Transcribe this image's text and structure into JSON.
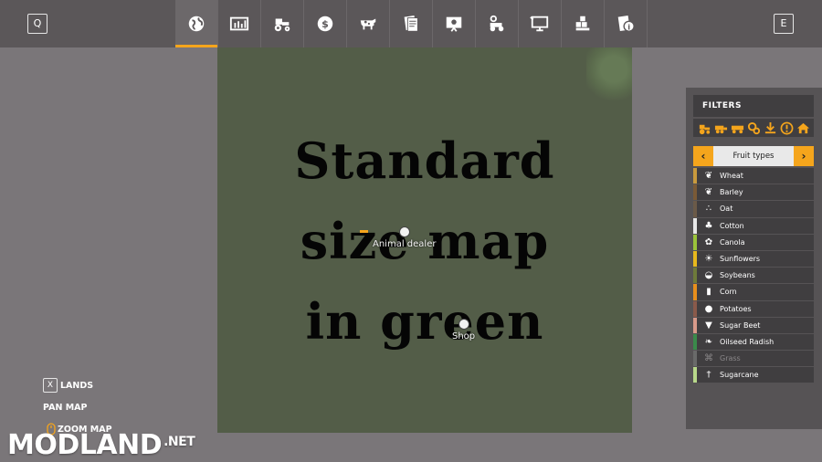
{
  "topbar": {
    "left_key": "Q",
    "right_key": "E",
    "tabs": [
      {
        "icon": "globe-icon",
        "active": true
      },
      {
        "icon": "stats-icon",
        "active": false
      },
      {
        "icon": "tractor-icon",
        "active": false
      },
      {
        "icon": "money-icon",
        "active": false
      },
      {
        "icon": "cow-icon",
        "active": false
      },
      {
        "icon": "contracts-icon",
        "active": false
      },
      {
        "icon": "help-board-icon",
        "active": false
      },
      {
        "icon": "vehicle-icon",
        "active": false
      },
      {
        "icon": "screen-icon",
        "active": false
      },
      {
        "icon": "production-icon",
        "active": false
      },
      {
        "icon": "info-icon",
        "active": false
      }
    ]
  },
  "map": {
    "title_line1": "Standard",
    "title_line2": "size map",
    "title_line3": "in green",
    "animal_dealer": "Animal dealer",
    "shop": "Shop"
  },
  "controls": {
    "lands_key": "X",
    "lands": "LANDS",
    "pan_map": "PAN MAP",
    "zoom_map": "ZOOM MAP"
  },
  "watermark": {
    "brand": "MODLAND",
    "tld": ".NET"
  },
  "filters": {
    "title": "FILTERS",
    "category": "Fruit types",
    "accent_color": "#f5a51c",
    "fruits": [
      {
        "name": "Wheat",
        "color": "#c99a3d",
        "disabled": false
      },
      {
        "name": "Barley",
        "color": "#7a5a36",
        "disabled": false
      },
      {
        "name": "Oat",
        "color": "#6b5a48",
        "disabled": false
      },
      {
        "name": "Cotton",
        "color": "#e8e8e8",
        "disabled": false
      },
      {
        "name": "Canola",
        "color": "#9bc43a",
        "disabled": false
      },
      {
        "name": "Sunflowers",
        "color": "#e8b91c",
        "disabled": false
      },
      {
        "name": "Soybeans",
        "color": "#6e7a3a",
        "disabled": false
      },
      {
        "name": "Corn",
        "color": "#e88f1c",
        "disabled": false
      },
      {
        "name": "Potatoes",
        "color": "#8a5a4a",
        "disabled": false
      },
      {
        "name": "Sugar Beet",
        "color": "#d89a8a",
        "disabled": false
      },
      {
        "name": "Oilseed Radish",
        "color": "#3a8a4a",
        "disabled": false
      },
      {
        "name": "Grass",
        "color": "#6a6a6a",
        "disabled": true
      },
      {
        "name": "Sugarcane",
        "color": "#b8d88a",
        "disabled": false
      }
    ]
  }
}
